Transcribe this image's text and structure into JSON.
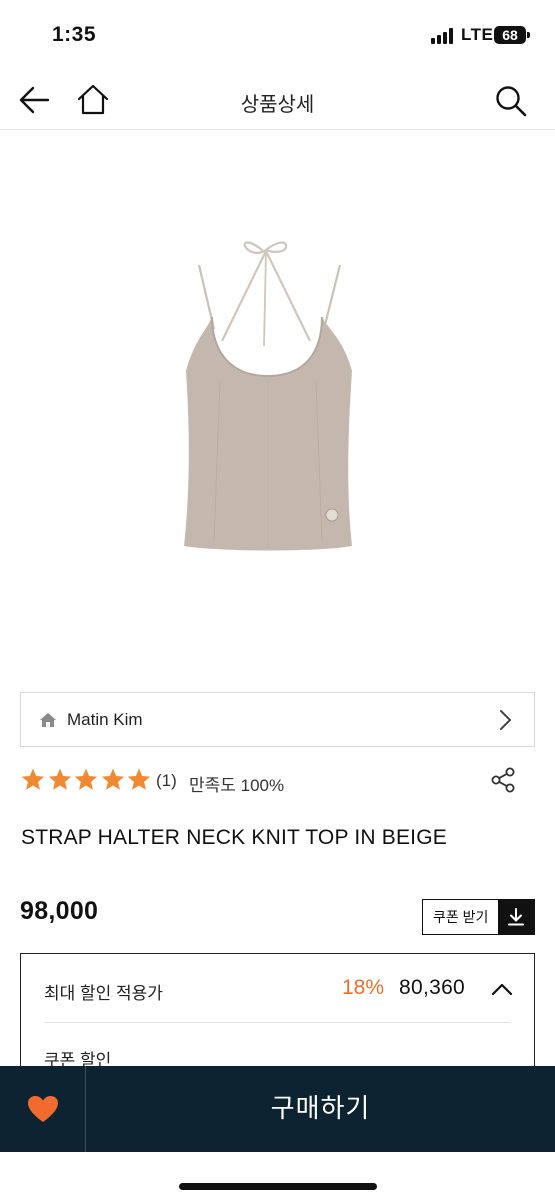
{
  "status_bar": {
    "time": "1:35",
    "network": "LTE",
    "battery": "68"
  },
  "nav": {
    "title": "상품상세",
    "icons": [
      "back-arrow-icon",
      "home-icon",
      "search-icon"
    ]
  },
  "product": {
    "image_alt": "halter neck knit top",
    "image_color": "#c4b8ae",
    "brand": "Matin Kim",
    "rating": {
      "stars": 5,
      "count": "(1)",
      "satisfaction": "만족도 100%"
    },
    "title": "STRAP HALTER NECK KNIT TOP IN BEIGE",
    "price": "98,000",
    "coupon_button": "쿠폰 받기"
  },
  "discount": {
    "label": "최대 할인 적용가",
    "rate": "18%",
    "price": "80,360",
    "coupon_label": "쿠폰 할인"
  },
  "bottom_bar": {
    "buy_label": "구매하기",
    "wish_icon": "heart-icon"
  },
  "colors": {
    "accent": "#e8702a",
    "star": "#ef8a32",
    "bottom_bar": "#0d2332"
  }
}
